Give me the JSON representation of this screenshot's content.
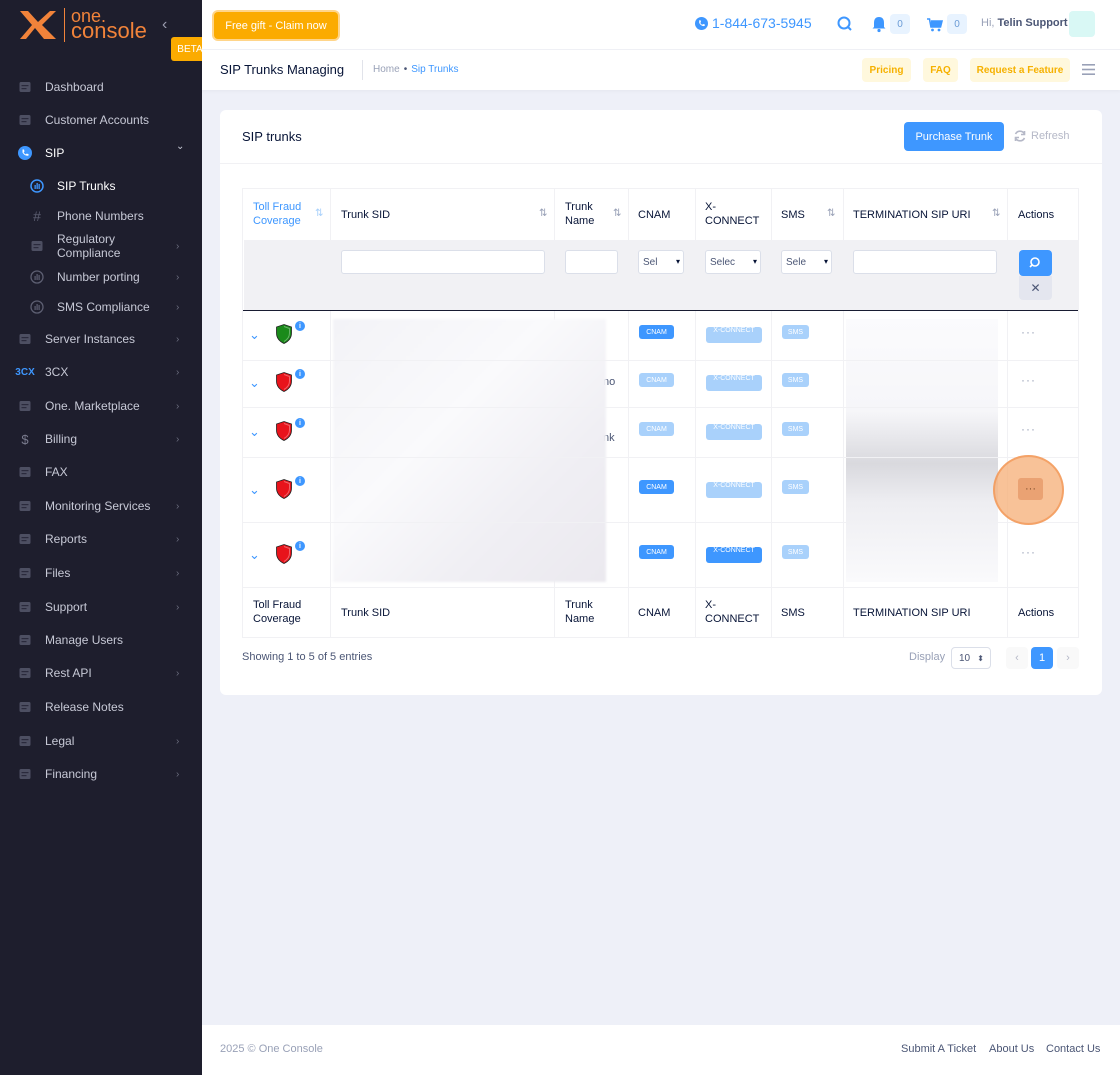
{
  "brand": {
    "logo_one": "one.",
    "logo_console": "console",
    "beta": "BETA"
  },
  "sidebar": {
    "items": [
      {
        "label": "Dashboard",
        "icon": "layers-icon"
      },
      {
        "label": "Customer Accounts",
        "icon": "user-icon"
      },
      {
        "label": "SIP",
        "icon": "phone-icon"
      },
      {
        "label": "SIP Trunks",
        "icon": "bars-circle-icon"
      },
      {
        "label": "Phone Numbers",
        "icon": "hash-icon"
      },
      {
        "label": "Regulatory Compliance",
        "icon": "id-card-icon"
      },
      {
        "label": "Number porting",
        "icon": "bars-circle-icon"
      },
      {
        "label": "SMS Compliance",
        "icon": "bars-circle-icon"
      },
      {
        "label": "Server Instances",
        "icon": "server-icon"
      },
      {
        "label": "3CX",
        "icon": "3cx-icon"
      },
      {
        "label": "One. Marketplace",
        "icon": "marketplace-icon"
      },
      {
        "label": "Billing",
        "icon": "dollar-icon"
      },
      {
        "label": "FAX",
        "icon": "fax-icon"
      },
      {
        "label": "Monitoring Services",
        "icon": "chart-line-icon"
      },
      {
        "label": "Reports",
        "icon": "reports-icon"
      },
      {
        "label": "Files",
        "icon": "file-icon"
      },
      {
        "label": "Support",
        "icon": "support-icon"
      },
      {
        "label": "Manage Users",
        "icon": "user-icon"
      },
      {
        "label": "Rest API",
        "icon": "api-icon"
      },
      {
        "label": "Release Notes",
        "icon": "notes-icon"
      },
      {
        "label": "Legal",
        "icon": "legal-icon"
      },
      {
        "label": "Financing",
        "icon": "financing-icon"
      }
    ],
    "collapse": "‹"
  },
  "topbar": {
    "gift_label": "Free gift - Claim now",
    "phone": "1-844-673-5945",
    "notif_count": "0",
    "cart_count": "0",
    "greet_prefix": "Hi,",
    "user_name": "Telin Support"
  },
  "subheader": {
    "title": "SIP Trunks Managing",
    "crumb_home": "Home",
    "crumb_current": "Sip Trunks",
    "pricing": "Pricing",
    "faq": "FAQ",
    "request": "Request a Feature"
  },
  "card": {
    "title": "SIP trunks",
    "purchase": "Purchase Trunk",
    "refresh": "Refresh"
  },
  "table": {
    "headers": {
      "toll": "Toll Fraud Coverage",
      "sid": "Trunk SID",
      "name": "Trunk Name",
      "cnam": "CNAM",
      "xconnect": "X-CONNECT",
      "sms": "SMS",
      "uri": "TERMINATION SIP URI",
      "actions": "Actions"
    },
    "filters": {
      "cnam": "Sel",
      "xconnect": "Selec",
      "sms": "Sele"
    },
    "rows": [
      {
        "shield": "#1a8a1a",
        "cnam_tag": "CNAM",
        "cnam_on": true,
        "x_tag": "X-CONNECT",
        "x_on": false,
        "sms_tag": "SMS",
        "name_partial": ""
      },
      {
        "shield": "#e8131b",
        "cnam_tag": "CNAM",
        "cnam_on": false,
        "x_tag": "X-CONNECT",
        "x_on": false,
        "sms_tag": "SMS",
        "name_partial": "no"
      },
      {
        "shield": "#e8131b",
        "cnam_tag": "CNAM",
        "cnam_on": false,
        "x_tag": "X-CONNECT",
        "x_on": false,
        "sms_tag": "SMS",
        "name_partial": "nk"
      },
      {
        "shield": "#e8131b",
        "cnam_tag": "CNAM",
        "cnam_on": true,
        "x_tag": "X-CONNECT",
        "x_on": false,
        "sms_tag": "SMS",
        "name_partial": ""
      },
      {
        "shield": "#e8131b",
        "cnam_tag": "CNAM",
        "cnam_on": true,
        "x_tag": "X-CONNECT",
        "x_on": true,
        "sms_tag": "SMS",
        "name_partial": ""
      }
    ],
    "actions_dots": "···"
  },
  "pagination": {
    "showing": "Showing 1 to 5 of 5 entries",
    "display_label": "Display",
    "page_size": "10",
    "current_page": "1",
    "prev": "‹",
    "next": "›"
  },
  "footer": {
    "copyright": "2025 © One Console",
    "submit": "Submit A Ticket",
    "about": "About Us",
    "contact": "Contact Us"
  },
  "colors": {
    "accent": "#3e97ff",
    "brand": "#f1833a",
    "warning": "#fbab00",
    "sidebar": "#1e1e2d"
  }
}
